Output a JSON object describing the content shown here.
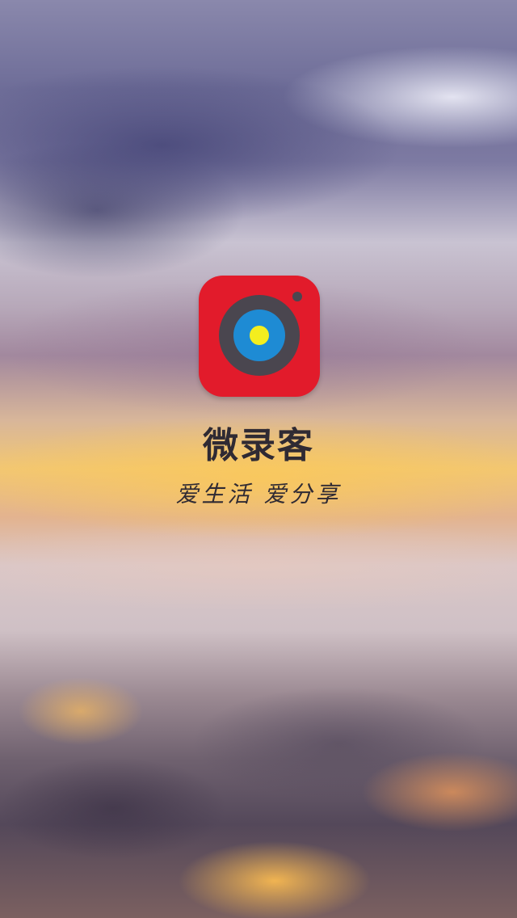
{
  "splash": {
    "app_name": "微录客",
    "slogan": "爱生活 爱分享",
    "icon": {
      "name": "camera-lens-icon",
      "colors": {
        "background": "#e21b2b",
        "lens_ring": "#4a464f",
        "lens_middle": "#1e8bd4",
        "lens_center": "#f4ee1e",
        "dot": "#4a4650"
      }
    },
    "text_color": "#2f2a33"
  }
}
